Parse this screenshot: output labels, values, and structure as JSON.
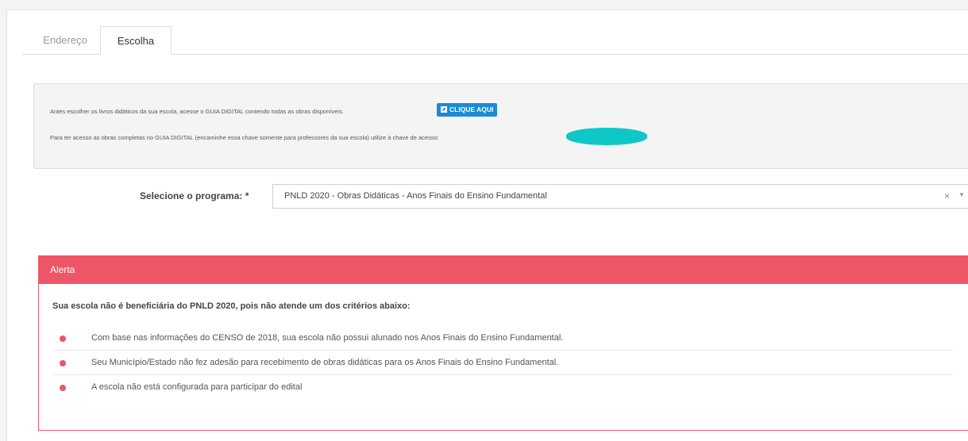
{
  "tabs": [
    {
      "label": "Endereço"
    },
    {
      "label": "Escolha"
    }
  ],
  "info": {
    "line1": "Antes escolher os livros didáticos da sua escola, acesse o GUIA DIGITAL contendo todas as obras disponíveis.",
    "button_label": "CLIQUE AQUI",
    "line2": "Para ter acesso as obras completas no GUIA DIGITAL (encaminhe essa chave somente para professores da sua escola) utilize à chave de acesso:"
  },
  "form": {
    "label": "Selecione o programa: *",
    "selected_value": "PNLD 2020 - Obras Didáticas - Anos Finais do Ensino Fundamental",
    "clear_glyph": "×",
    "arrow_glyph": "▼"
  },
  "alert": {
    "title": "Alerta",
    "heading": "Sua escola não é beneficiária do PNLD 2020, pois não atende um dos critérios abaixo:",
    "criteria": [
      "Com base nas informações do CENSO de 2018, sua escola não possui alunado nos Anos Finais do Ensino Fundamental.",
      "Seu Município/Estado não fez adesão para recebimento de obras didáticas para os Anos Finais do Ensino Fundamental.",
      "A escola não está configurada para participar do edital"
    ]
  },
  "colors": {
    "alert_red": "#ee5566",
    "button_blue": "#1b8bd6",
    "redaction_teal": "#0fc7c7"
  }
}
